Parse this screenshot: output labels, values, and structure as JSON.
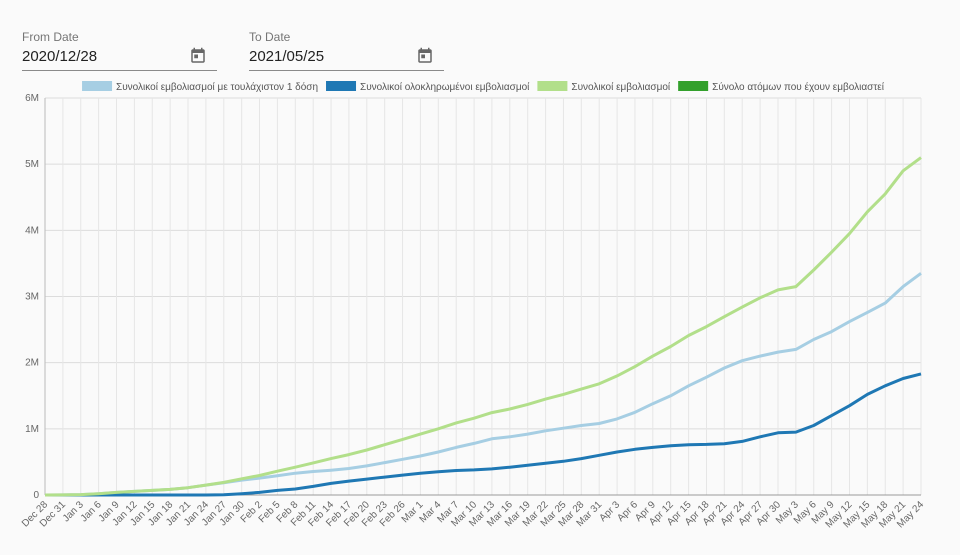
{
  "filters": {
    "from": {
      "label": "From Date",
      "value": "2020/12/28"
    },
    "to": {
      "label": "To Date",
      "value": "2021/05/25"
    }
  },
  "chart_data": {
    "type": "line",
    "x_labels": [
      "Dec 28",
      "Dec 31",
      "Jan 3",
      "Jan 6",
      "Jan 9",
      "Jan 12",
      "Jan 15",
      "Jan 18",
      "Jan 21",
      "Jan 24",
      "Jan 27",
      "Jan 30",
      "Feb 2",
      "Feb 5",
      "Feb 8",
      "Feb 11",
      "Feb 14",
      "Feb 17",
      "Feb 20",
      "Feb 23",
      "Feb 26",
      "Mar 1",
      "Mar 4",
      "Mar 7",
      "Mar 10",
      "Mar 13",
      "Mar 16",
      "Mar 19",
      "Mar 22",
      "Mar 25",
      "Mar 28",
      "Mar 31",
      "Apr 3",
      "Apr 6",
      "Apr 9",
      "Apr 12",
      "Apr 15",
      "Apr 18",
      "Apr 21",
      "Apr 24",
      "Apr 27",
      "Apr 30",
      "May 3",
      "May 6",
      "May 9",
      "May 12",
      "May 15",
      "May 18",
      "May 21",
      "May 24"
    ],
    "y_ticks": [
      "0",
      "1M",
      "2M",
      "3M",
      "4M",
      "5M",
      "6M"
    ],
    "ylim": [
      0,
      6000000
    ],
    "grid": true,
    "legend_position": "top",
    "series": [
      {
        "name": "Συνολικοί εμβολιασμοί με τουλάχιστον 1 δόση",
        "color": "#a6cee3",
        "values": [
          0,
          2000,
          6000,
          20000,
          40000,
          55000,
          70000,
          85000,
          110000,
          150000,
          185000,
          225000,
          255000,
          290000,
          330000,
          355000,
          375000,
          400000,
          440000,
          490000,
          540000,
          590000,
          650000,
          720000,
          780000,
          850000,
          880000,
          920000,
          970000,
          1010000,
          1050000,
          1080000,
          1150000,
          1250000,
          1380000,
          1500000,
          1650000,
          1780000,
          1920000,
          2030000,
          2100000,
          2160000,
          2200000,
          2350000,
          2470000,
          2620000,
          2760000,
          2900000,
          3150000,
          3350000
        ]
      },
      {
        "name": "Συνολικοί ολοκληρωμένοι εμβολιασμοί",
        "color": "#1f78b4",
        "values": [
          0,
          0,
          0,
          0,
          0,
          0,
          0,
          0,
          0,
          0,
          5000,
          20000,
          40000,
          70000,
          90000,
          130000,
          175000,
          210000,
          240000,
          270000,
          300000,
          330000,
          350000,
          370000,
          380000,
          395000,
          420000,
          450000,
          480000,
          510000,
          550000,
          600000,
          650000,
          690000,
          720000,
          745000,
          760000,
          765000,
          775000,
          810000,
          880000,
          940000,
          950000,
          1050000,
          1200000,
          1350000,
          1520000,
          1650000,
          1760000,
          1830000
        ]
      },
      {
        "name": "Συνολικοί εμβολιασμοί",
        "color": "#b2df8a",
        "values": [
          0,
          2000,
          6000,
          20000,
          40000,
          55000,
          70000,
          85000,
          110000,
          150000,
          190000,
          245000,
          295000,
          360000,
          420000,
          485000,
          550000,
          610000,
          680000,
          760000,
          840000,
          920000,
          1000000,
          1090000,
          1160000,
          1245000,
          1300000,
          1370000,
          1450000,
          1520000,
          1600000,
          1680000,
          1800000,
          1940000,
          2100000,
          2245000,
          2410000,
          2545000,
          2695000,
          2840000,
          2980000,
          3100000,
          3150000,
          3400000,
          3670000,
          3950000,
          4280000,
          4550000,
          4900000,
          5100000
        ]
      },
      {
        "name": "Σύνολο ατόμων που έχουν εμβολιαστεί",
        "color": "#33a02c",
        "values": []
      }
    ]
  }
}
